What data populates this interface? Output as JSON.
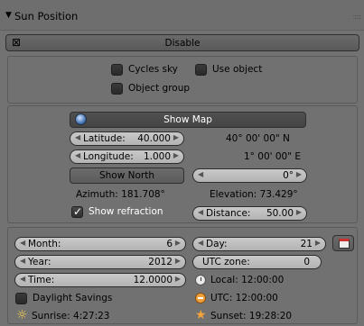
{
  "panel": {
    "title": "Sun Position",
    "collapse_icon": "triangle-down-icon",
    "grip": ":::::"
  },
  "disable_button": {
    "label": "Disable",
    "icon": "close-icon"
  },
  "options": {
    "cycles_sky": "Cycles sky",
    "use_object": "Use object",
    "object_group": "Object group"
  },
  "location": {
    "show_map": "Show Map",
    "latitude_label": "Latitude:",
    "latitude_value": "40.000",
    "latitude_dms": "40° 00' 00\" N",
    "longitude_label": "Longitude:",
    "longitude_value": "1.000",
    "longitude_dms": "1° 00' 00\" E",
    "show_north": "Show North",
    "north_value": "0°",
    "azimuth": "Azimuth: 181.708°",
    "elevation": "Elevation: 73.429°",
    "show_refraction": "Show refraction",
    "distance_label": "Distance:",
    "distance_value": "50.00"
  },
  "time": {
    "month_label": "Month:",
    "month_value": "6",
    "day_label": "Day:",
    "day_value": "21",
    "year_label": "Year:",
    "year_value": "2012",
    "utc_zone_label": "UTC zone:",
    "utc_zone_value": "0",
    "time_label": "Time:",
    "time_value": "12.0000",
    "local_time": "Local: 12:00:00",
    "daylight_savings": "Daylight Savings",
    "utc_time": "UTC: 12:00:00",
    "sunrise": "Sunrise: 4:27:23",
    "sunset": "Sunset: 19:28:20"
  }
}
